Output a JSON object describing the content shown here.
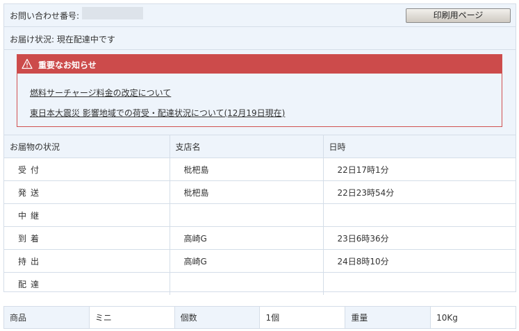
{
  "inquiry": {
    "label": "お問い合わせ番号:",
    "value": "",
    "print_button": "印刷用ページ"
  },
  "status": {
    "text": "お届け状況: 現在配達中です"
  },
  "notice": {
    "icon": "warning-icon",
    "title": "重要なお知らせ",
    "links": [
      "燃料サーチャージ料金の改定について",
      "東日本大震災 影響地域での荷受・配達状況について(12月19日現在)"
    ],
    "colors": {
      "header": "#cc4b4b",
      "border": "#d05050"
    }
  },
  "tracking": {
    "headers": [
      "お届物の状況",
      "支店名",
      "日時"
    ],
    "rows": [
      {
        "status": "受付",
        "branch": "枇杷島",
        "datetime": "22日17時1分"
      },
      {
        "status": "発送",
        "branch": "枇杷島",
        "datetime": "22日23時54分"
      },
      {
        "status": "中継",
        "branch": "",
        "datetime": ""
      },
      {
        "status": "到着",
        "branch": "高崎G",
        "datetime": "23日6時36分"
      },
      {
        "status": "持出",
        "branch": "高崎G",
        "datetime": "24日8時10分"
      },
      {
        "status": "配達",
        "branch": "",
        "datetime": ""
      }
    ]
  },
  "product": {
    "item_label": "商品",
    "item_value": "ミニ",
    "qty_label": "個数",
    "qty_value": "1個",
    "weight_label": "重量",
    "weight_value": "10Kg"
  },
  "colors": {
    "panel_bg": "#eef4fb",
    "border": "#d4dde8"
  }
}
